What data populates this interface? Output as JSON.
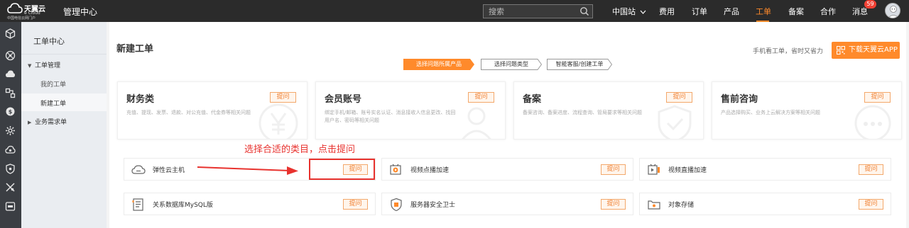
{
  "header": {
    "brand": "天翼云",
    "brand_en": "e Cloud",
    "brand_sub": "中国电信云网门户",
    "console": "管理中心",
    "search_placeholder": "搜索",
    "nav": [
      {
        "label": "中国站",
        "icon": "chevron-down-icon"
      },
      {
        "label": "费用"
      },
      {
        "label": "订单"
      },
      {
        "label": "产品"
      },
      {
        "label": "工单",
        "active": true
      },
      {
        "label": "备案"
      },
      {
        "label": "合作"
      },
      {
        "label": "消息"
      }
    ],
    "message_count": "59",
    "accent": "#ff8a2b"
  },
  "sidebar": {
    "title": "工单中心",
    "groups": [
      {
        "label": "工单管理",
        "expanded": true,
        "items": [
          "我的工单",
          "新建工单"
        ]
      },
      {
        "label": "业务需求单",
        "expanded": false
      }
    ],
    "active_item": "新建工单"
  },
  "main": {
    "title": "新建工单",
    "promo_text": "手机看工单，省时又省力",
    "app_button": "下载天翼云APP",
    "steps": [
      "选择问题所属产品",
      "选择问题类型",
      "智能客服/创建工单"
    ],
    "categories": [
      {
        "title": "财务类",
        "desc": "充值、提现、发票、退款、对公充值、代金券等相关问题",
        "ask": "提问",
        "icon": "yen-watermark-icon"
      },
      {
        "title": "会员账号",
        "desc": "绑定手机/邮箱、账号实名认证、消息接收人信息更改、找回用户名、密码等相关问题",
        "ask": "提问",
        "icon": "user-watermark-icon"
      },
      {
        "title": "备案",
        "desc": "备案咨询、备案进度、流程查询、管局要求等相关问题",
        "ask": "提问",
        "icon": "shield-watermark-icon"
      },
      {
        "title": "售前咨询",
        "desc": "产品选择购买、业务上云解决方案等相关问题",
        "ask": "提问",
        "icon": "chat-watermark-icon"
      }
    ],
    "products": [
      {
        "name": "弹性云主机",
        "ask": "提问",
        "icon": "cloud-host-icon"
      },
      {
        "name": "视频点播加速",
        "ask": "提问",
        "icon": "video-vod-icon"
      },
      {
        "name": "视频直播加速",
        "ask": "提问",
        "icon": "video-live-icon"
      },
      {
        "name": "关系数据库MySQL版",
        "ask": "提问",
        "icon": "database-icon"
      },
      {
        "name": "服务器安全卫士",
        "ask": "提问",
        "icon": "server-security-icon"
      },
      {
        "name": "对象存储",
        "ask": "提问",
        "icon": "object-storage-icon"
      }
    ]
  },
  "annotation": {
    "text": "选择合适的类目，点击提问",
    "color": "#e8322e"
  }
}
